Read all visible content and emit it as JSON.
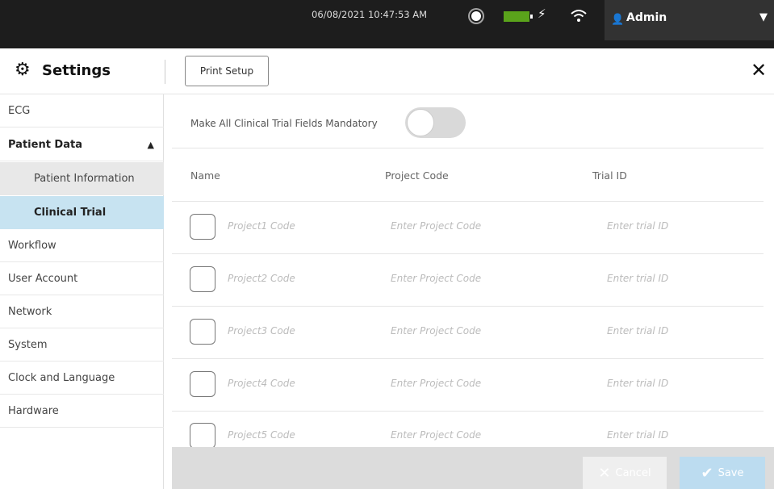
{
  "topbar": {
    "datetime": "06/08/2021 10:47:53 AM",
    "user": "Admin",
    "icons": [
      "brightness-icon",
      "battery-icon",
      "charging-icon",
      "wifi-icon",
      "user-icon",
      "chevron-down-icon"
    ],
    "battery_color": "#5aa31b"
  },
  "header": {
    "title": "Settings",
    "print_setup_label": "Print Setup"
  },
  "sidebar": {
    "items": [
      {
        "label": "ECG"
      },
      {
        "label": "Patient Data"
      },
      {
        "label": "Patient Information"
      },
      {
        "label": "Clinical Trial"
      },
      {
        "label": "Workflow"
      },
      {
        "label": "User Account"
      },
      {
        "label": "Network"
      },
      {
        "label": "System"
      },
      {
        "label": "Clock and Language"
      },
      {
        "label": "Hardware"
      }
    ],
    "active_item": "Clinical Trial",
    "active_color": "#c7e3f1"
  },
  "main": {
    "mandatory_label": "Make All Clinical Trial Fields Mandatory",
    "mandatory_on": false,
    "columns": [
      "Name",
      "Project Code",
      "Trial ID"
    ],
    "rows": [
      {
        "name": "Project1 Code",
        "project_code": "Enter Project Code",
        "trial_id": "Enter trial ID"
      },
      {
        "name": "Project2 Code",
        "project_code": "Enter Project Code",
        "trial_id": "Enter trial ID"
      },
      {
        "name": "Project3 Code",
        "project_code": "Enter Project Code",
        "trial_id": "Enter trial ID"
      },
      {
        "name": "Project4 Code",
        "project_code": "Enter Project Code",
        "trial_id": "Enter trial ID"
      },
      {
        "name": "Project5 Code",
        "project_code": "Enter Project Code",
        "trial_id": "Enter trial ID"
      }
    ]
  },
  "footer": {
    "cancel_label": "Cancel",
    "save_label": "Save"
  }
}
